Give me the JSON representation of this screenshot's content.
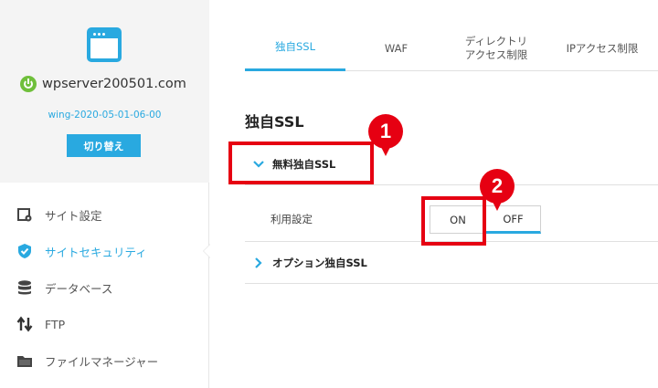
{
  "sidebar": {
    "server_name": "wpserver200501.com",
    "server_version": "wing-2020-05-01-06-00",
    "switch_label": "切り替え",
    "items": [
      {
        "label": "サイト設定",
        "icon": "site-settings-icon"
      },
      {
        "label": "サイトセキュリティ",
        "icon": "shield-check-icon",
        "active": true
      },
      {
        "label": "データベース",
        "icon": "database-icon"
      },
      {
        "label": "FTP",
        "icon": "transfer-arrows-icon"
      },
      {
        "label": "ファイルマネージャー",
        "icon": "folder-icon"
      }
    ]
  },
  "tabs": [
    {
      "label": "独自SSL",
      "active": true
    },
    {
      "label": "WAF"
    },
    {
      "label": "ディレクトリ\nアクセス制限"
    },
    {
      "label": "IPアクセス制限"
    }
  ],
  "main": {
    "section_title": "独自SSL",
    "free_ssl_label": "無料独自SSL",
    "usage_label": "利用設定",
    "on_label": "ON",
    "off_label": "OFF",
    "option_ssl_label": "オプション独自SSL"
  },
  "annotations": {
    "badge1": "1",
    "badge2": "2"
  },
  "colors": {
    "accent": "#29a9e0",
    "annotation_red": "#e60012",
    "power_green": "#6fbf3b"
  }
}
